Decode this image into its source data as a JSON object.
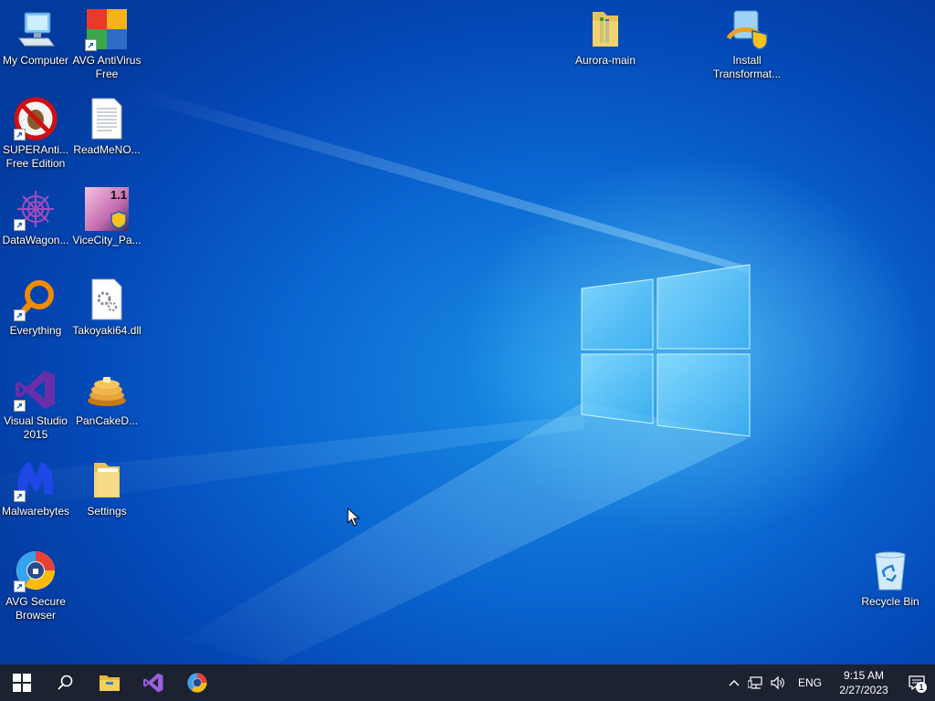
{
  "desktop": {
    "icons": {
      "my_computer": "My Computer",
      "avg_antivirus": "AVG AntiVirus Free",
      "superantispyware": "SUPERAnti... Free Edition",
      "readme": "ReadMeNO...",
      "datawagon": "DataWagon...",
      "vicecity": "ViceCity_Pa...",
      "everything": "Everything",
      "takoyaki": "Takoyaki64.dll",
      "visual_studio": "Visual Studio 2015",
      "pancake": "PanCakeD...",
      "malwarebytes": "Malwarebytes",
      "settings": "Settings",
      "avg_browser": "AVG Secure Browser",
      "aurora": "Aurora-main",
      "install_transformat": "Install Transformat...",
      "recycle_bin": "Recycle Bin"
    },
    "vicecity_badge": "1.1"
  },
  "taskbar": {
    "start": "start-windows-icon",
    "pinned": [
      "search-icon",
      "file-explorer-icon",
      "visual-studio-icon",
      "avg-browser-icon"
    ],
    "tray": {
      "language": "ENG",
      "time": "9:15 AM",
      "date": "2/27/2023",
      "notifications_count": "1"
    }
  },
  "colors": {
    "taskbar_bg": "#1c2230",
    "desktop_blue": "#0a66d0",
    "accent": "#1a8fe6"
  }
}
